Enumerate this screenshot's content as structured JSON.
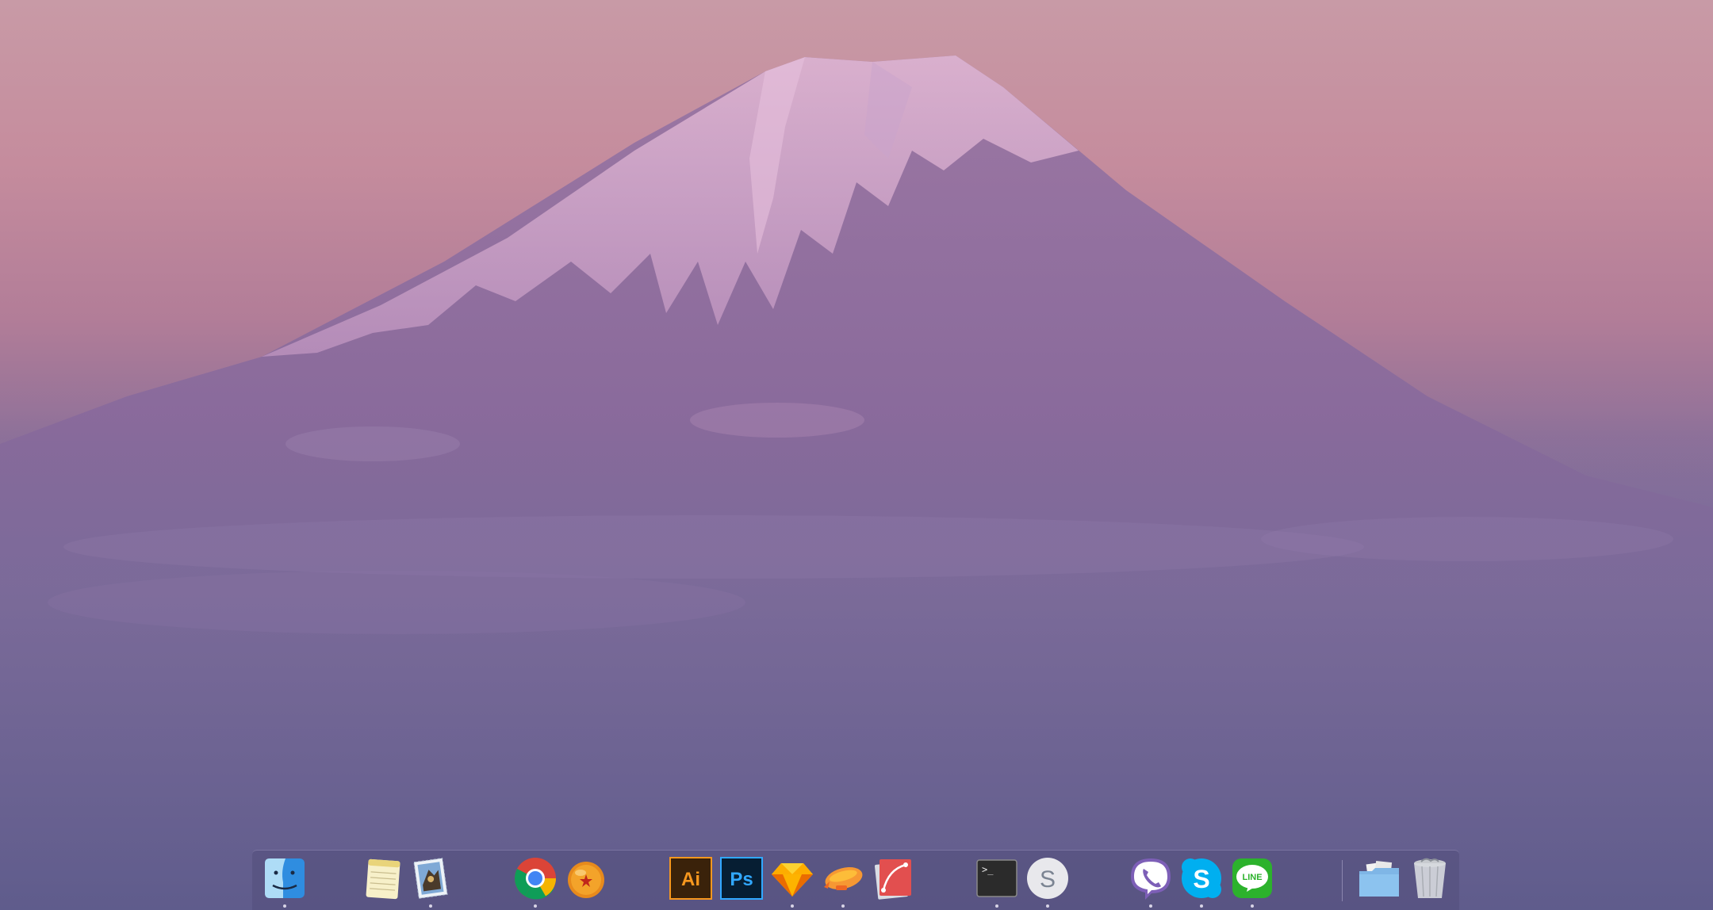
{
  "desktop": {
    "wallpaper": "mount-fuji-at-dusk",
    "colors": {
      "sky": "#c89aa6",
      "mountain": "#8b6a9a",
      "snow": "#d7a8cc",
      "clouds": "#9a7eaa"
    }
  },
  "dock": {
    "items": [
      {
        "name": "finder",
        "icon": "finder-icon",
        "running": true
      },
      {
        "name": "notes",
        "icon": "notes-icon",
        "running": false
      },
      {
        "name": "mail",
        "icon": "mail-stamp-icon",
        "running": true
      },
      {
        "name": "chrome",
        "icon": "chrome-icon",
        "running": true
      },
      {
        "name": "dragon-ball-app",
        "icon": "orange-star-ball-icon",
        "running": false
      },
      {
        "name": "illustrator",
        "icon": "illustrator-icon",
        "label": "Ai",
        "running": false
      },
      {
        "name": "photoshop",
        "icon": "photoshop-icon",
        "label": "Ps",
        "running": false
      },
      {
        "name": "sketch",
        "icon": "sketch-diamond-icon",
        "running": true
      },
      {
        "name": "zeplin",
        "icon": "zeplin-blimp-icon",
        "running": true
      },
      {
        "name": "graphic-app",
        "icon": "pen-curve-icon",
        "running": false
      },
      {
        "name": "terminal",
        "icon": "terminal-icon",
        "label": ">_",
        "running": true
      },
      {
        "name": "simplenote",
        "icon": "simplenote-icon",
        "label": "S",
        "running": true
      },
      {
        "name": "viber",
        "icon": "viber-icon",
        "running": true
      },
      {
        "name": "skype",
        "icon": "skype-icon",
        "label": "S",
        "running": true
      },
      {
        "name": "line",
        "icon": "line-icon",
        "label": "LINE",
        "running": true
      },
      {
        "name": "downloads-folder",
        "icon": "folder-icon",
        "running": false
      },
      {
        "name": "trash",
        "icon": "trash-icon",
        "running": false
      }
    ]
  }
}
